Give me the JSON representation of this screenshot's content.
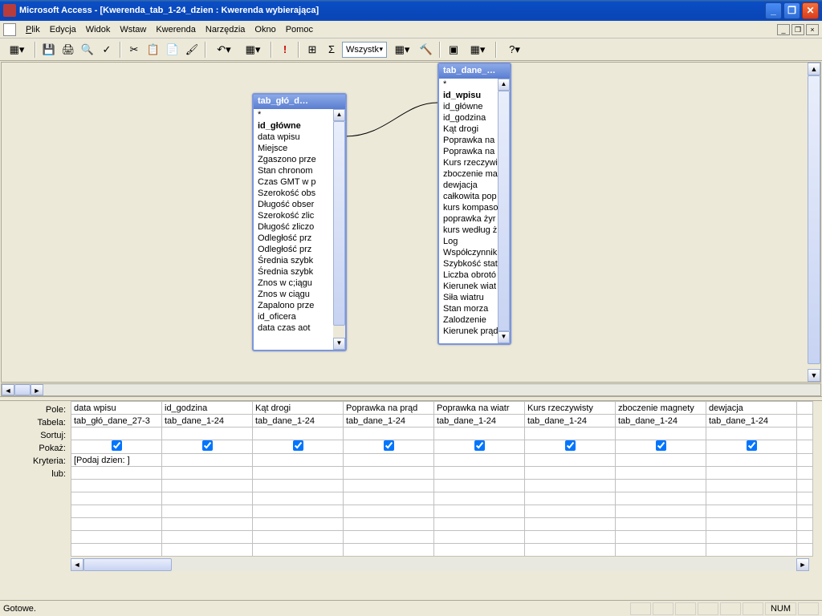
{
  "titlebar": "Microsoft Access - [Kwerenda_tab_1-24_dzien : Kwerenda wybierająca]",
  "menu": {
    "plik": "Plik",
    "edycja": "Edycja",
    "widok": "Widok",
    "wstaw": "Wstaw",
    "kwerenda": "Kwerenda",
    "narzedzia": "Narzędzia",
    "okno": "Okno",
    "pomoc": "Pomoc"
  },
  "toolbar": {
    "all_label": "Wszystk"
  },
  "table1": {
    "title": "tab_głó_d…",
    "fields": [
      "*",
      "id_główne",
      "data wpisu",
      "Miejsce",
      "Zgaszono prze",
      "Stan chronom",
      "Czas GMT w p",
      "Szerokość obs",
      "Długość obser",
      "Szerokość zlic",
      "Długość zliczo",
      "Odległość prz",
      "Odległość prz",
      "Średnia szybk",
      "Średnia szybk",
      "Znos w c;iągu",
      "Znos w ciągu",
      "Zapalono prze",
      "id_oficera",
      "data czas aot"
    ]
  },
  "table2": {
    "title": "tab_dane_…",
    "fields": [
      "*",
      "id_wpisu",
      "id_główne",
      "id_godzina",
      "Kąt drogi",
      "Poprawka na",
      "Poprawka na",
      "Kurs rzeczywi",
      "zboczenie ma",
      "dewjacja",
      "całkowita pop",
      "kurs kompaso",
      "poprawka żyr",
      "kurs według ż",
      "Log",
      "Współczynnik",
      "Szybkość stat",
      "Liczba obrotó",
      "Kierunek wiat",
      "Siła wiatru",
      "Stan morza",
      "Zalodzenie",
      "Kierunek prąd"
    ]
  },
  "grid": {
    "labels": {
      "pole": "Pole:",
      "tabela": "Tabela:",
      "sortuj": "Sortuj:",
      "pokaz": "Pokaż:",
      "kryteria": "Kryteria:",
      "lub": "lub:"
    },
    "cols": [
      {
        "pole": "data wpisu",
        "tabela": "tab_głó_dane_27-3",
        "kryt": "[Podaj dzien: ]"
      },
      {
        "pole": "id_godzina",
        "tabela": "tab_dane_1-24",
        "kryt": ""
      },
      {
        "pole": "Kąt drogi",
        "tabela": "tab_dane_1-24",
        "kryt": ""
      },
      {
        "pole": "Poprawka na prąd",
        "tabela": "tab_dane_1-24",
        "kryt": ""
      },
      {
        "pole": "Poprawka na wiatr",
        "tabela": "tab_dane_1-24",
        "kryt": ""
      },
      {
        "pole": "Kurs rzeczywisty",
        "tabela": "tab_dane_1-24",
        "kryt": ""
      },
      {
        "pole": "zboczenie magnety",
        "tabela": "tab_dane_1-24",
        "kryt": ""
      },
      {
        "pole": "dewjacja",
        "tabela": "tab_dane_1-24",
        "kryt": ""
      }
    ]
  },
  "status": {
    "ready": "Gotowe.",
    "num": "NUM"
  }
}
